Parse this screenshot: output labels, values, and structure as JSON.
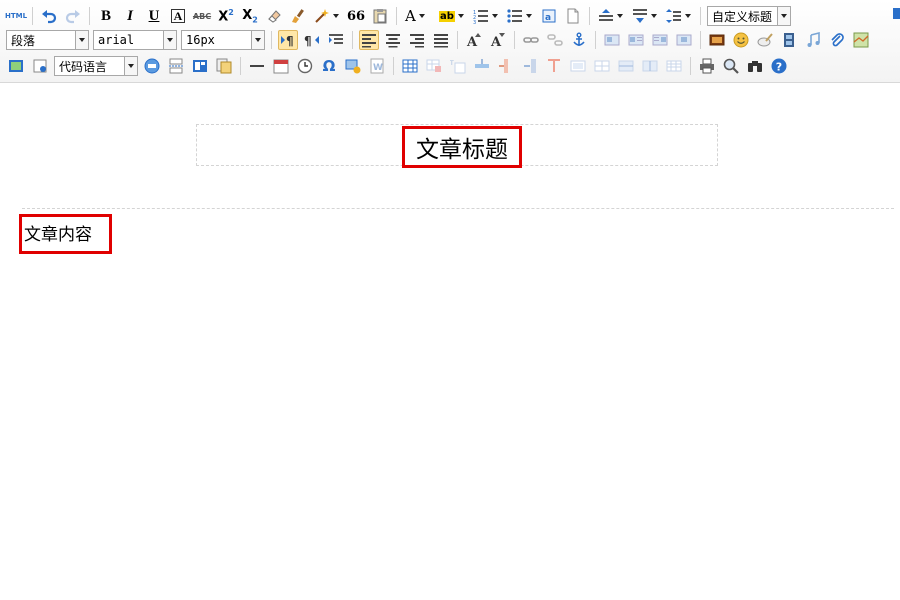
{
  "toolbar": {
    "paragraph_select": "段落",
    "font_family_select": "arial",
    "font_size_select": "16px",
    "custom_title_select": "自定义标题",
    "code_language_select": "代码语言",
    "html_label": "HTML",
    "bold_label": "B",
    "italic_label": "I",
    "underline_label": "U",
    "fontborder_label": "A",
    "strike_label": "ABC",
    "superscript_label": "X",
    "superscript_sup": "2",
    "subscript_label": "X",
    "subscript_sub": "2",
    "blockquote_label": "66",
    "forecolor_label": "A",
    "backcolor_label": "ab"
  },
  "editor": {
    "title": "文章标题",
    "content": "文章内容"
  },
  "colors": {
    "highlight_border": "#e00000",
    "active_button_bg": "#ffe7a8",
    "icon_blue": "#2a6fc9"
  }
}
